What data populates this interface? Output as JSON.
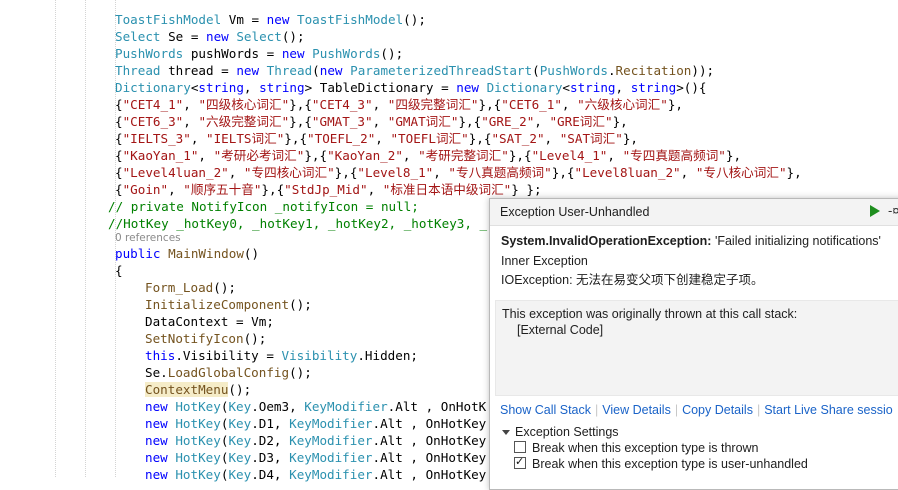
{
  "code": {
    "lines": [
      [
        [
          "ty",
          "ToastFishModel"
        ],
        [
          "",
          " Vm = "
        ],
        [
          "kw",
          "new"
        ],
        [
          "",
          " "
        ],
        [
          "ty",
          "ToastFishModel"
        ],
        [
          "",
          "();"
        ]
      ],
      [
        [
          "ty",
          "Select"
        ],
        [
          "",
          " Se = "
        ],
        [
          "kw",
          "new"
        ],
        [
          "",
          " "
        ],
        [
          "ty",
          "Select"
        ],
        [
          "",
          "();"
        ]
      ],
      [
        [
          "ty",
          "PushWords"
        ],
        [
          "",
          " pushWords = "
        ],
        [
          "kw",
          "new"
        ],
        [
          "",
          " "
        ],
        [
          "ty",
          "PushWords"
        ],
        [
          "",
          "();"
        ]
      ],
      [
        [
          "ty",
          "Thread"
        ],
        [
          "",
          " thread = "
        ],
        [
          "kw",
          "new"
        ],
        [
          "",
          " "
        ],
        [
          "ty",
          "Thread"
        ],
        [
          "",
          "("
        ],
        [
          "kw",
          "new"
        ],
        [
          "",
          " "
        ],
        [
          "ty",
          "ParameterizedThreadStart"
        ],
        [
          "",
          "("
        ],
        [
          "ty",
          "PushWords"
        ],
        [
          "",
          "."
        ],
        [
          "mt",
          "Recitation"
        ],
        [
          "",
          "));"
        ]
      ],
      [
        [
          "ty",
          "Dictionary"
        ],
        [
          "",
          "<"
        ],
        [
          "kw",
          "string"
        ],
        [
          "",
          ", "
        ],
        [
          "kw",
          "string"
        ],
        [
          "",
          "> TableDictionary = "
        ],
        [
          "kw",
          "new"
        ],
        [
          "",
          " "
        ],
        [
          "ty",
          "Dictionary"
        ],
        [
          "",
          "<"
        ],
        [
          "kw",
          "string"
        ],
        [
          "",
          ", "
        ],
        [
          "kw",
          "string"
        ],
        [
          "",
          ">(){"
        ]
      ],
      [
        [
          "",
          "{"
        ],
        [
          "st",
          "\"CET4_1\""
        ],
        [
          "",
          ", "
        ],
        [
          "st",
          "\"四级核心词汇\""
        ],
        [
          "",
          "},{"
        ],
        [
          "st",
          "\"CET4_3\""
        ],
        [
          "",
          ", "
        ],
        [
          "st",
          "\"四级完整词汇\""
        ],
        [
          "",
          "},{"
        ],
        [
          "st",
          "\"CET6_1\""
        ],
        [
          "",
          ", "
        ],
        [
          "st",
          "\"六级核心词汇\""
        ],
        [
          "",
          "},"
        ]
      ],
      [
        [
          "",
          "{"
        ],
        [
          "st",
          "\"CET6_3\""
        ],
        [
          "",
          ", "
        ],
        [
          "st",
          "\"六级完整词汇\""
        ],
        [
          "",
          "},{"
        ],
        [
          "st",
          "\"GMAT_3\""
        ],
        [
          "",
          ", "
        ],
        [
          "st",
          "\"GMAT词汇\""
        ],
        [
          "",
          "},{"
        ],
        [
          "st",
          "\"GRE_2\""
        ],
        [
          "",
          ", "
        ],
        [
          "st",
          "\"GRE词汇\""
        ],
        [
          "",
          "},"
        ]
      ],
      [
        [
          "",
          "{"
        ],
        [
          "st",
          "\"IELTS_3\""
        ],
        [
          "",
          ", "
        ],
        [
          "st",
          "\"IELTS词汇\""
        ],
        [
          "",
          "},{"
        ],
        [
          "st",
          "\"TOEFL_2\""
        ],
        [
          "",
          ", "
        ],
        [
          "st",
          "\"TOEFL词汇\""
        ],
        [
          "",
          "},{"
        ],
        [
          "st",
          "\"SAT_2\""
        ],
        [
          "",
          ", "
        ],
        [
          "st",
          "\"SAT词汇\""
        ],
        [
          "",
          "},"
        ]
      ],
      [
        [
          "",
          "{"
        ],
        [
          "st",
          "\"KaoYan_1\""
        ],
        [
          "",
          ", "
        ],
        [
          "st",
          "\"考研必考词汇\""
        ],
        [
          "",
          "},{"
        ],
        [
          "st",
          "\"KaoYan_2\""
        ],
        [
          "",
          ", "
        ],
        [
          "st",
          "\"考研完整词汇\""
        ],
        [
          "",
          "},{"
        ],
        [
          "st",
          "\"Level4_1\""
        ],
        [
          "",
          ", "
        ],
        [
          "st",
          "\"专四真题高频词\""
        ],
        [
          "",
          "},"
        ]
      ],
      [
        [
          "",
          "{"
        ],
        [
          "st",
          "\"Level4luan_2\""
        ],
        [
          "",
          ", "
        ],
        [
          "st",
          "\"专四核心词汇\""
        ],
        [
          "",
          "},{"
        ],
        [
          "st",
          "\"Level8_1\""
        ],
        [
          "",
          ", "
        ],
        [
          "st",
          "\"专八真题高频词\""
        ],
        [
          "",
          "},{"
        ],
        [
          "st",
          "\"Level8luan_2\""
        ],
        [
          "",
          ", "
        ],
        [
          "st",
          "\"专八核心词汇\""
        ],
        [
          "",
          "},"
        ]
      ],
      [
        [
          "",
          "{"
        ],
        [
          "st",
          "\"Goin\""
        ],
        [
          "",
          ", "
        ],
        [
          "st",
          "\"顺序五十音\""
        ],
        [
          "",
          "},{"
        ],
        [
          "st",
          "\"StdJp_Mid\""
        ],
        [
          "",
          ", "
        ],
        [
          "st",
          "\"标准日本语中级词汇\""
        ],
        [
          "",
          "} };"
        ]
      ],
      [
        [
          "cm",
          "// private NotifyIcon _notifyIcon = null;"
        ]
      ],
      [
        [
          "cm",
          "//HotKey _hotKey0, _hotKey1, _hotKey2, _hotKey3, _"
        ]
      ],
      [
        [
          "kw",
          "public"
        ],
        [
          "",
          " "
        ],
        [
          "mt",
          "MainWindow"
        ],
        [
          "",
          "()"
        ]
      ],
      [
        [
          "",
          "{"
        ]
      ],
      [
        [
          "mt",
          "Form_Load"
        ],
        [
          "",
          "();"
        ]
      ],
      [
        [
          "mt",
          "InitializeComponent"
        ],
        [
          "",
          "();"
        ]
      ],
      [
        [
          "",
          "DataContext = Vm;"
        ]
      ],
      [
        [
          "mt",
          "SetNotifyIcon"
        ],
        [
          "",
          "();"
        ]
      ],
      [
        [
          "kw",
          "this"
        ],
        [
          "",
          ".Visibility = "
        ],
        [
          "enum",
          "Visibility"
        ],
        [
          "",
          ".Hidden;"
        ]
      ],
      [
        [
          "",
          "Se."
        ],
        [
          "mt",
          "LoadGlobalConfig"
        ],
        [
          "",
          "();"
        ]
      ],
      [
        [
          "mt",
          "ContextMenu"
        ],
        [
          "",
          "();"
        ]
      ],
      [
        [
          "kw",
          "new"
        ],
        [
          "",
          " "
        ],
        [
          "ty",
          "HotKey"
        ],
        [
          "",
          "("
        ],
        [
          "enum",
          "Key"
        ],
        [
          "",
          ".Oem3, "
        ],
        [
          "enum",
          "KeyModifier"
        ],
        [
          "",
          ".Alt , OnHotK"
        ]
      ],
      [
        [
          "kw",
          "new"
        ],
        [
          "",
          " "
        ],
        [
          "ty",
          "HotKey"
        ],
        [
          "",
          "("
        ],
        [
          "enum",
          "Key"
        ],
        [
          "",
          ".D1, "
        ],
        [
          "enum",
          "KeyModifier"
        ],
        [
          "",
          ".Alt , OnHotKey"
        ]
      ],
      [
        [
          "kw",
          "new"
        ],
        [
          "",
          " "
        ],
        [
          "ty",
          "HotKey"
        ],
        [
          "",
          "("
        ],
        [
          "enum",
          "Key"
        ],
        [
          "",
          ".D2, "
        ],
        [
          "enum",
          "KeyModifier"
        ],
        [
          "",
          ".Alt , OnHotKey"
        ]
      ],
      [
        [
          "kw",
          "new"
        ],
        [
          "",
          " "
        ],
        [
          "ty",
          "HotKey"
        ],
        [
          "",
          "("
        ],
        [
          "enum",
          "Key"
        ],
        [
          "",
          ".D3, "
        ],
        [
          "enum",
          "KeyModifier"
        ],
        [
          "",
          ".Alt , OnHotKey"
        ]
      ],
      [
        [
          "kw",
          "new"
        ],
        [
          "",
          " "
        ],
        [
          "ty",
          "HotKey"
        ],
        [
          "",
          "("
        ],
        [
          "enum",
          "Key"
        ],
        [
          "",
          ".D4, "
        ],
        [
          "enum",
          "KeyModifier"
        ],
        [
          "",
          ".Alt , OnHotKey"
        ]
      ]
    ],
    "references_label": "0 references"
  },
  "exception": {
    "title": "Exception User-Unhandled",
    "type": "System.InvalidOperationException:",
    "message": " 'Failed initializing notifications'",
    "inner_label": "Inner Exception",
    "inner_message": "IOException: 无法在易变父项下创建稳定子项。",
    "stack_title": "This exception was originally thrown at this call stack:",
    "stack_entry": "[External Code]",
    "links": [
      "Show Call Stack",
      "View Details",
      "Copy Details",
      "Start Live Share sessio"
    ],
    "settings_label": "Exception Settings",
    "options": [
      {
        "label": "Break when this exception type is thrown",
        "checked": false
      },
      {
        "label": "Break when this exception type is user-unhandled",
        "checked": true
      }
    ]
  }
}
